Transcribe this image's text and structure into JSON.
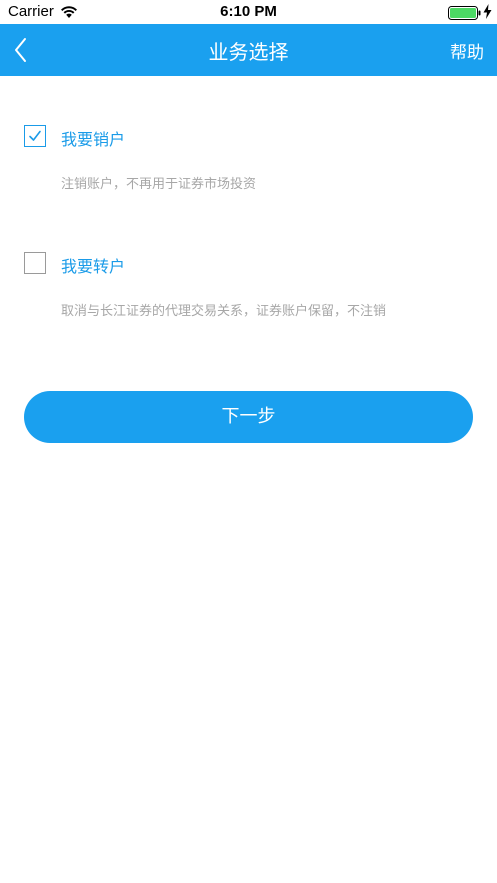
{
  "status_bar": {
    "carrier": "Carrier",
    "time": "6:10 PM",
    "wifi_icon": "wifi-icon",
    "battery_icon": "battery-icon",
    "charge_icon": "lightning-icon"
  },
  "nav": {
    "back_icon": "chevron-left-icon",
    "title": "业务选择",
    "help_label": "帮助",
    "background_color": "#1aa0ef"
  },
  "options": [
    {
      "label": "我要销户",
      "description": "注销账户，不再用于证券市场投资",
      "checked": true
    },
    {
      "label": "我要转户",
      "description": "取消与长江证券的代理交易关系，证券账户保留，不注销",
      "checked": false
    }
  ],
  "next_button": {
    "label": "下一步"
  },
  "colors": {
    "accent": "#1aa0ef",
    "label_blue": "#1a9be8",
    "muted_text": "#a7a7a7"
  }
}
